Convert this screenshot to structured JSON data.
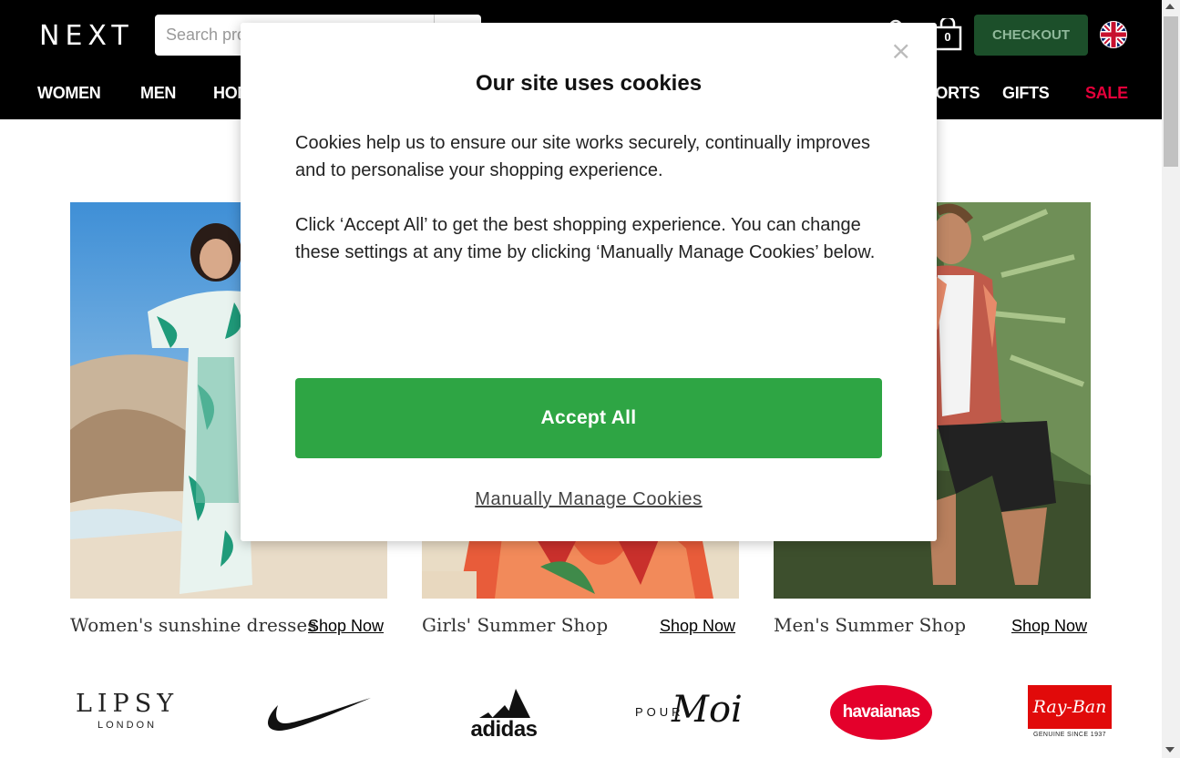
{
  "header": {
    "logo": "NEXT",
    "search_placeholder": "Search product or brand",
    "bag_count": "0",
    "checkout_label": "CHECKOUT"
  },
  "nav": {
    "items": [
      "WOMEN",
      "MEN",
      "HOME",
      "SPORTS",
      "GIFTS",
      "SALE"
    ]
  },
  "tiles": [
    {
      "caption": "Women's sunshine dresses",
      "link": "Shop Now"
    },
    {
      "caption": "Girls' Summer Shop",
      "link": "Shop Now"
    },
    {
      "caption": "Men's Summer Shop",
      "link": "Shop Now"
    }
  ],
  "brands": {
    "lipsy": "LIPSY",
    "lipsy_sub": "LONDON",
    "adidas": "adidas",
    "pourmoi_pour": "POUR",
    "pourmoi_moi": "Moi",
    "havaianas": "havaianas",
    "rayban": "Ray-Ban",
    "rayban_sub": "GENUINE SINCE 1937"
  },
  "modal": {
    "close": "×",
    "title": "Our site uses cookies",
    "p1": "Cookies help us to ensure our site works securely, continually improves and to personalise your shopping experience.",
    "p2": "Click ‘Accept All’ to get the best shopping experience. You can change these settings at any time by clicking ‘Manually Manage Cookies’ below.",
    "accept_label": "Accept All",
    "manage_label": "Manually Manage Cookies"
  },
  "colors": {
    "accept": "#2ea544",
    "checkout": "#1c4f2a",
    "sale": "#e4003a"
  }
}
